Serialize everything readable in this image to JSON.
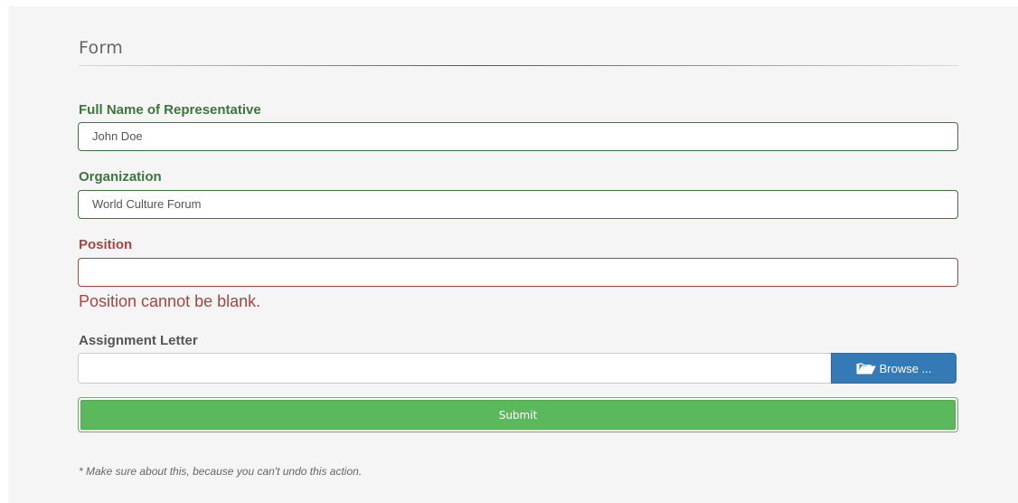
{
  "form": {
    "legend": "Form",
    "fields": {
      "full_name": {
        "label": "Full Name of Representative",
        "value": "John Doe"
      },
      "organization": {
        "label": "Organization",
        "value": "World Culture Forum"
      },
      "position": {
        "label": "Position",
        "value": "",
        "error": "Position cannot be blank."
      },
      "assignment_letter": {
        "label": "Assignment Letter",
        "value": "",
        "browse_label": "Browse ...",
        "browse_icon": "folder-open-icon"
      }
    },
    "submit_label": "Submit",
    "note": "* Make sure about this, because you can't undo this action."
  },
  "colors": {
    "success": "#3c763d",
    "error": "#a94442",
    "primary": "#337ab7",
    "submit": "#5cb85c",
    "panel_bg": "#f5f5f5"
  }
}
